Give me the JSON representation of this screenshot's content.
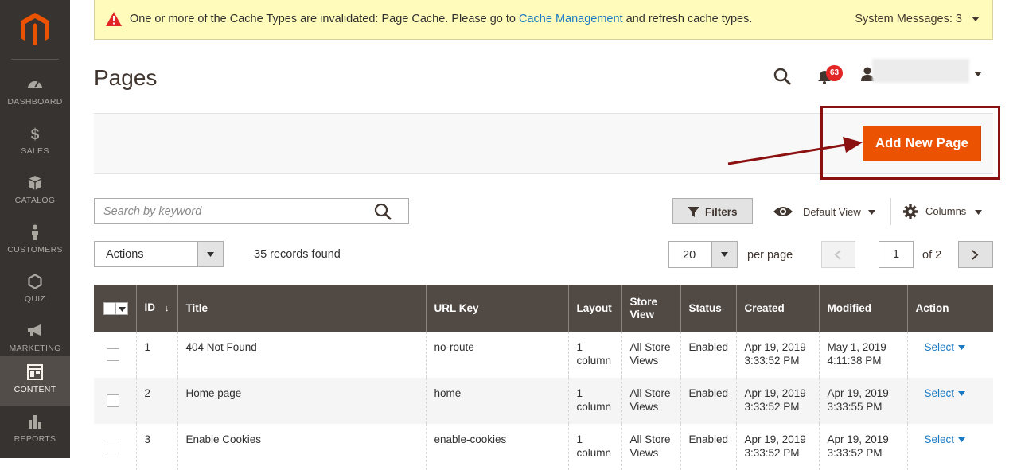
{
  "sidebar": {
    "items": [
      {
        "label": "DASHBOARD",
        "icon": "dashboard-gauge-icon"
      },
      {
        "label": "SALES",
        "icon": "dollar-icon"
      },
      {
        "label": "CATALOG",
        "icon": "cube-icon"
      },
      {
        "label": "CUSTOMERS",
        "icon": "person-icon"
      },
      {
        "label": "QUIZ",
        "icon": "hexagon-icon"
      },
      {
        "label": "MARKETING",
        "icon": "megaphone-icon"
      },
      {
        "label": "CONTENT",
        "icon": "layout-icon",
        "active": true
      },
      {
        "label": "REPORTS",
        "icon": "bar-chart-icon"
      }
    ]
  },
  "system_message": {
    "text_before": "One or more of the Cache Types are invalidated: Page Cache. Please go to ",
    "link": "Cache Management",
    "text_after": " and refresh cache types.",
    "count_label": "System Messages: 3"
  },
  "header": {
    "title": "Pages",
    "notifications_count": "63"
  },
  "actions": {
    "add_button": "Add New Page"
  },
  "toolbar": {
    "search_placeholder": "Search by keyword",
    "filters_label": "Filters",
    "view_label": "Default View",
    "columns_label": "Columns",
    "mass_actions_label": "Actions",
    "records_found": "35 records found",
    "per_page_value": "20",
    "per_page_label": "per page",
    "current_page": "1",
    "total_pages_label": "of 2"
  },
  "grid": {
    "columns": [
      "ID",
      "Title",
      "URL Key",
      "Layout",
      "Store View",
      "Status",
      "Created",
      "Modified",
      "Action"
    ],
    "rows": [
      {
        "id": "1",
        "title": "404 Not Found",
        "url_key": "no-route",
        "layout": "1 column",
        "store_view": "All Store Views",
        "status": "Enabled",
        "created": "Apr 19, 2019 3:33:52 PM",
        "modified": "May 1, 2019 4:11:38 PM",
        "action": "Select"
      },
      {
        "id": "2",
        "title": "Home page",
        "url_key": "home",
        "layout": "1 column",
        "store_view": "All Store Views",
        "status": "Enabled",
        "created": "Apr 19, 2019 3:33:52 PM",
        "modified": "Apr 19, 2019 3:33:55 PM",
        "action": "Select"
      },
      {
        "id": "3",
        "title": "Enable Cookies",
        "url_key": "enable-cookies",
        "layout": "1 column",
        "store_view": "All Store Views",
        "status": "Enabled",
        "created": "Apr 19, 2019 3:33:52 PM",
        "modified": "Apr 19, 2019 3:33:52 PM",
        "action": "Select"
      }
    ]
  },
  "colors": {
    "sidebar_bg": "#373330",
    "accent_orange": "#eb5202",
    "grid_header_bg": "#514943",
    "link_blue": "#1979c3",
    "annotation_red": "#8b1111"
  }
}
